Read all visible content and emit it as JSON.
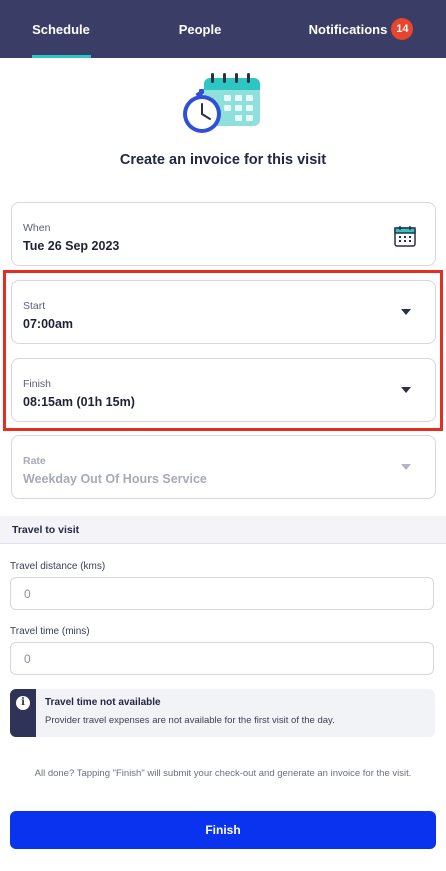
{
  "tabs": {
    "schedule": "Schedule",
    "people": "People",
    "notifications": "Notifications",
    "notifications_count": "14"
  },
  "title": "Create an invoice for this visit",
  "fields": {
    "when": {
      "label": "When",
      "value": "Tue 26 Sep 2023",
      "icon": "calendar-icon"
    },
    "start": {
      "label": "Start",
      "value": "07:00am"
    },
    "finish": {
      "label": "Finish",
      "value": "08:15am (01h 15m)"
    },
    "rate": {
      "label": "Rate",
      "value": "Weekday Out Of Hours Service",
      "disabled": true
    }
  },
  "travel": {
    "section_title": "Travel to visit",
    "distance_label": "Travel distance (kms)",
    "distance_placeholder": "0",
    "time_label": "Travel time (mins)",
    "time_placeholder": "0"
  },
  "notice": {
    "title": "Travel time not available",
    "body": "Provider travel expenses are not available for the first visit of the day."
  },
  "footnote": "All done? Tapping \"Finish\" will submit your check-out and generate an invoice for the visit.",
  "finish_button": "Finish",
  "colors": {
    "nav_bg": "#3a3d66",
    "tab_indicator": "#2ec6c2",
    "badge": "#e8452c",
    "highlight": "#e62e1e",
    "primary": "#0a33f0"
  }
}
